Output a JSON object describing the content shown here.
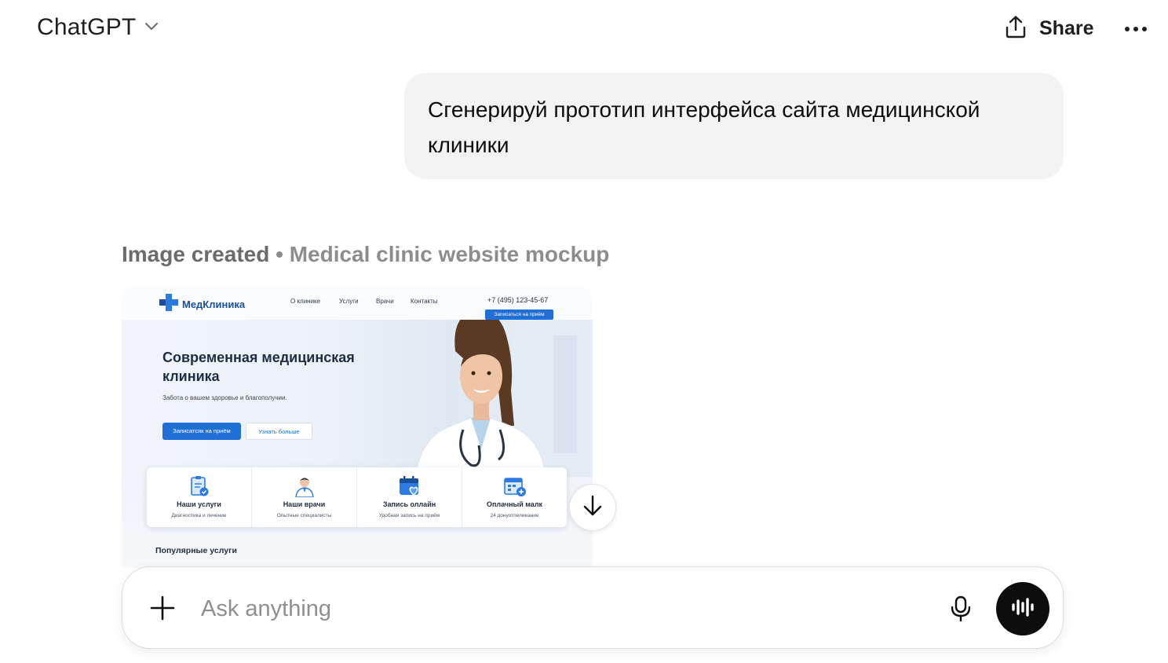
{
  "header": {
    "model_name": "ChatGPT",
    "share_label": "Share"
  },
  "conversation": {
    "user_message": "Сгенерируй прототип интерфейса сайта медицинской клиники",
    "image_status": "Image created",
    "image_status_sep": " • ",
    "image_title": "Medical clinic website mockup"
  },
  "mockup": {
    "logo": "МедКлиника",
    "nav": [
      "О клинике",
      "Услуги",
      "Врачи",
      "Контакты"
    ],
    "phone": "+7 (495) 123-45-67",
    "book_button": "Записаться на приём",
    "hero_title": "Современная медицинская клиника",
    "hero_subtitle": "Забота о вашем здоровье и благополучии.",
    "primary_button": "Записатсяк на приём",
    "secondary_button": "Узнать больше",
    "cards": [
      {
        "title": "Наши услуги",
        "sub": "Диагностика и лечение"
      },
      {
        "title": "Наши врачи",
        "sub": "Опытные специалисты"
      },
      {
        "title": "Запись оллайн",
        "sub": "Удобная запись на приём"
      },
      {
        "title": "Оплачный малк",
        "sub": "24 донуотпелиеание"
      }
    ],
    "section_title": "Популярные услуги"
  },
  "composer": {
    "placeholder": "Ask anything"
  },
  "colors": {
    "accent": "#1f6fd6",
    "user_bubble": "#f3f3f3",
    "voice_button": "#0d0d0d"
  }
}
